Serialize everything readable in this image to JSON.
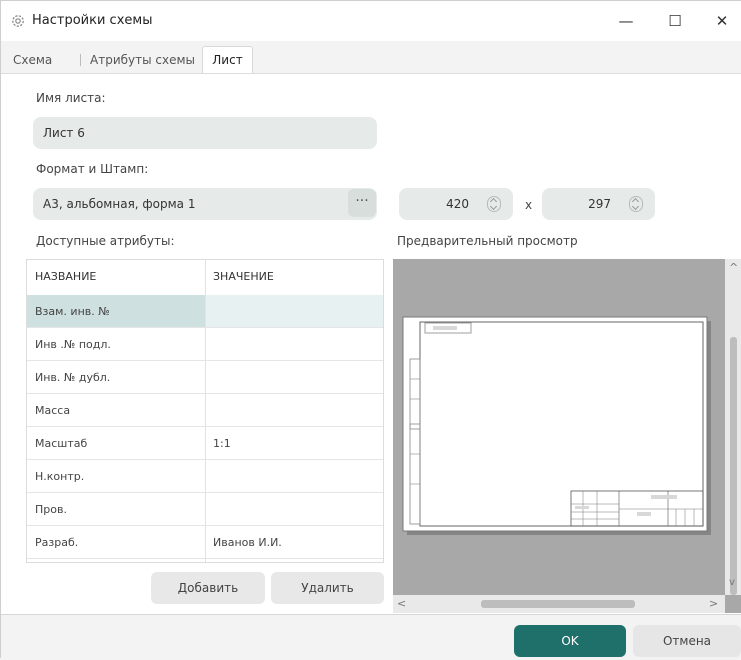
{
  "window": {
    "title": "Настройки схемы",
    "icon": "gear-icon",
    "minimize": "—",
    "maximize": "☐",
    "close": "✕"
  },
  "tabs": [
    {
      "label": "Схема",
      "active": false
    },
    {
      "label": "Атрибуты схемы",
      "active": false
    },
    {
      "label": "Лист",
      "active": true
    }
  ],
  "sheet": {
    "name_label": "Имя листа:",
    "name_value": "Лист 6",
    "format_label": "Формат и Штамп:",
    "format_value": "А3, альбомная, форма 1",
    "format_more": "···",
    "width_value": "420",
    "times": "x",
    "height_value": "297"
  },
  "attributes": {
    "label": "Доступные атрибуты:",
    "col_name": "НАЗВАНИЕ",
    "col_value": "ЗНАЧЕНИЕ",
    "rows": [
      {
        "name": "Взам. инв. №",
        "value": ""
      },
      {
        "name": "Инв .№ подл.",
        "value": ""
      },
      {
        "name": "Инв. № дубл.",
        "value": ""
      },
      {
        "name": "Масса",
        "value": ""
      },
      {
        "name": "Масштаб",
        "value": "1:1"
      },
      {
        "name": "Н.контр.",
        "value": ""
      },
      {
        "name": "Пров.",
        "value": ""
      },
      {
        "name": "Разраб.",
        "value": "Иванов И.И."
      }
    ],
    "add_label": "Добавить",
    "delete_label": "Удалить"
  },
  "preview": {
    "label": "Предварительный просмотр",
    "scroll_up": "^",
    "scroll_down": "v",
    "scroll_left": "<",
    "scroll_right": ">"
  },
  "footer": {
    "ok_label": "OK",
    "cancel_label": "Отмена"
  },
  "colors": {
    "accent": "#1f6f6a",
    "field_bg": "#e6ebea",
    "selection": "#cfe0e0"
  }
}
